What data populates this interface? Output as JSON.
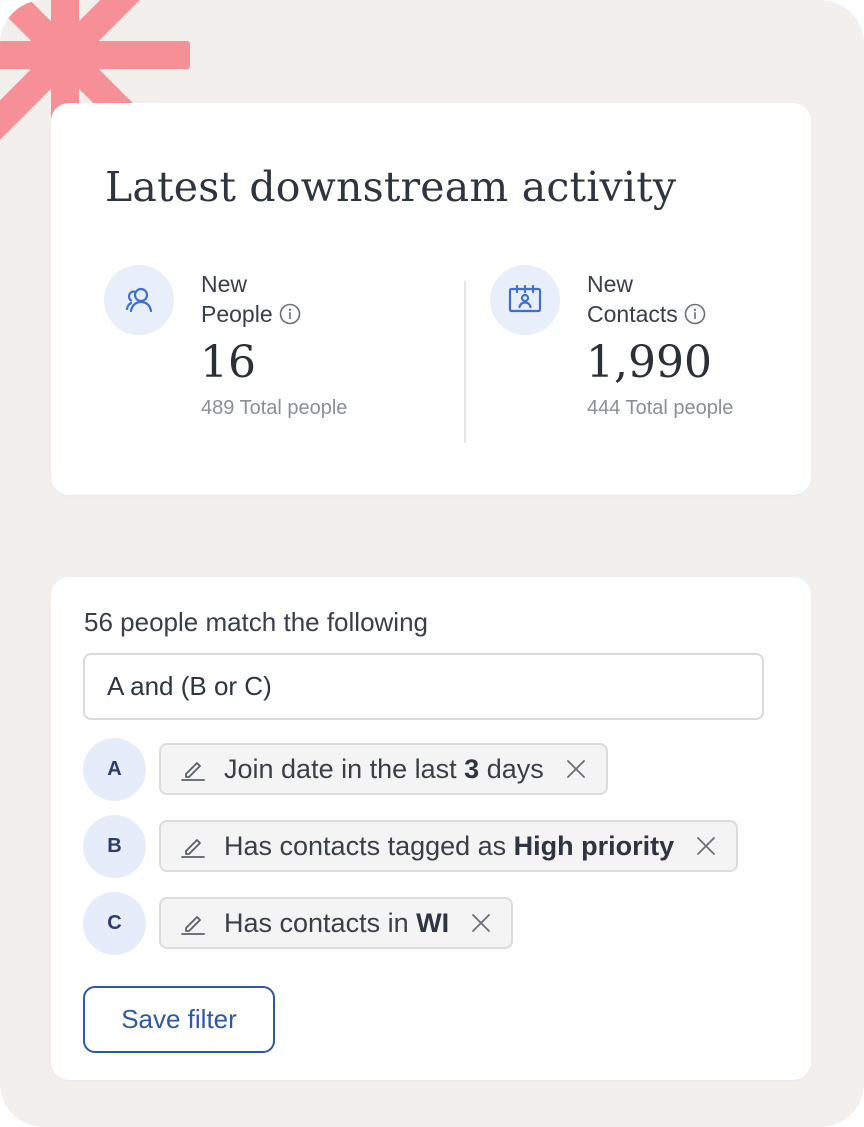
{
  "activity": {
    "title": "Latest downstream activity",
    "people": {
      "label_line1": "New",
      "label_line2": "People",
      "value": "16",
      "subtext": "489 Total people",
      "icon": "people-icon"
    },
    "contacts": {
      "label_line1": "New",
      "label_line2": "Contacts",
      "value": "1,990",
      "subtext": "444 Total people",
      "icon": "contact-card-icon"
    }
  },
  "filter": {
    "match_text": "56 people match the following",
    "expression_value": "A and (B or C)",
    "conditions": [
      {
        "letter": "A",
        "prefix": "Join date in the last ",
        "highlight": "3",
        "suffix": " days"
      },
      {
        "letter": "B",
        "prefix": "Has contacts tagged as ",
        "highlight": "High priority",
        "suffix": ""
      },
      {
        "letter": "C",
        "prefix": "Has contacts in ",
        "highlight": "WI",
        "suffix": ""
      }
    ],
    "save_label": "Save filter"
  },
  "colors": {
    "background": "#f2efec",
    "accent_burst": "#f79096",
    "primary_blue": "#2d58a4",
    "icon_circle": "#e8eefa"
  }
}
